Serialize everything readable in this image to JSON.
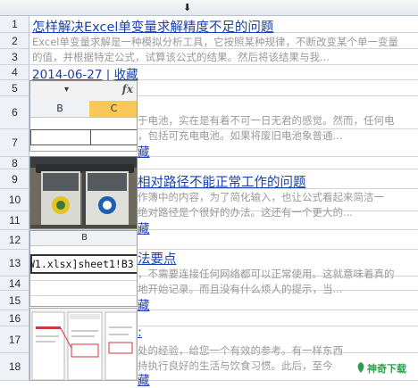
{
  "rows": [
    "1",
    "2",
    "3",
    "4",
    "5",
    "6",
    "7",
    "8",
    "9",
    "10",
    "11",
    "12",
    "13",
    "14",
    "15",
    "16",
    "17",
    "18"
  ],
  "articles": [
    {
      "title": "怎样解决Excel单变量求解精度不足的问题",
      "desc_line1": "Excel单变量求解是一种模拟分析工具，它按照某种规律，不断改变某个单一变量",
      "desc_line2": "的值，并根据特定公式，试算该公式的结果。然后将该结果与我...",
      "date": "2014-06-27",
      "sep": " | ",
      "fav": "收藏"
    },
    {
      "desc": "于电池，实在是有着不可一日无君的感觉。然而，任何电",
      "desc2": "，包括可充电电池。如果将废旧电池象普通...",
      "fav": "藏"
    },
    {
      "title": "相对路径不能正常工作的问题",
      "desc": "作簿中的内容，为了简化输入，也让公式看起来简洁一",
      "desc2": "绝对路径是个很好的办法。这还有一个更大的...",
      "fav": "藏"
    },
    {
      "title": "法要点",
      "desc": "，不需要连接任何网络都可以正常使用。这就意味着真的",
      "desc2": "地开始记录。而且没有什么烦人的提示，当...",
      "fav": "藏"
    },
    {
      "title": ":",
      "desc": "处的经验，给您一个有效的参考。有一样东西",
      "desc2": "持执行良好的生活与饮食习惯。此后，至今",
      "fav": "藏"
    }
  ],
  "overlay_formula_bar": {
    "dropdown": "▾",
    "fx": "fx",
    "col_b": "B",
    "col_c": "C"
  },
  "overlay_formula_cell": {
    "col": "B",
    "formula": "W1.xlsx]sheet1!B3"
  },
  "watermark": "神奇下载",
  "colors": {
    "link": "#1a3fb0",
    "desc": "#999999",
    "highlight_col": "#f9c85a"
  }
}
